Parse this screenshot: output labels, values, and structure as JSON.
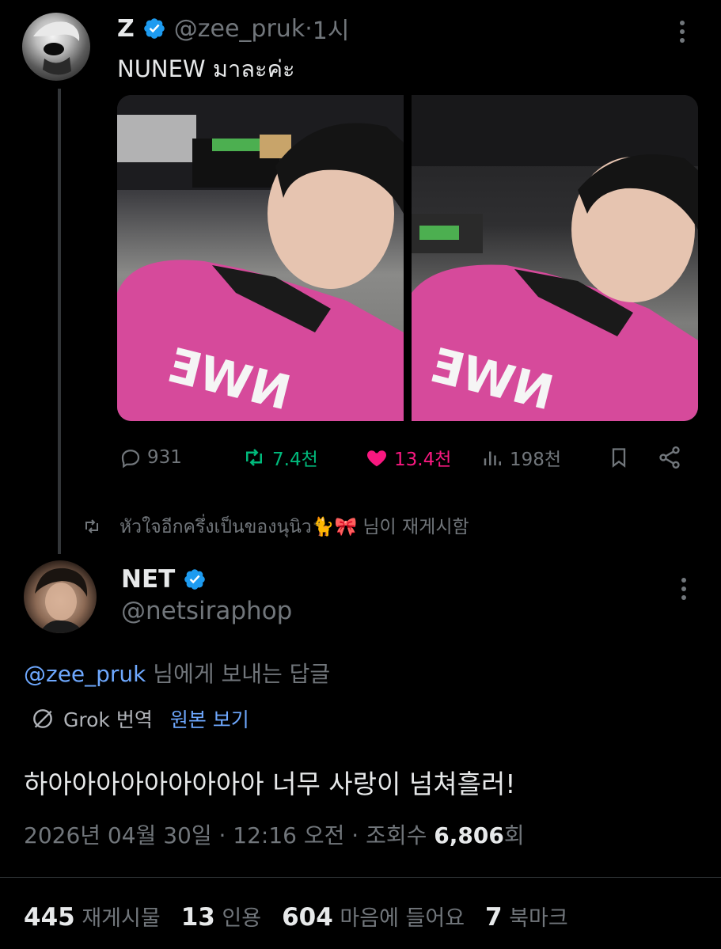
{
  "tweet1": {
    "name": "Z",
    "handle": "@zee_pruk",
    "sep": " · ",
    "time": "1시",
    "text": "NUNEW มาละค่ะ",
    "actions": {
      "replies": "931",
      "retweets": "7.4천",
      "likes": "13.4천",
      "views": "198천"
    }
  },
  "repost_notice": "หัวใจอีกครึ่งเป็นของนุนิว🐈🎀 님이 재게시함",
  "tweet2": {
    "name": "NET",
    "handle": "@netsiraphop",
    "reply_to_handle": "@zee_pruk",
    "reply_to_suffix": " 님에게 보내는 답글",
    "translate_label": "Grok 번역",
    "show_original": "원본 보기",
    "text": "하아아아아아아아아아 너무 사랑이 넘쳐흘러!",
    "meta_prefix": "2026년 04월 30일 · 12:16 오전 · 조회수 ",
    "views": "6,806",
    "views_suffix": "회",
    "stats": {
      "reposts_num": "445",
      "reposts_label": "재게시물",
      "quotes_num": "13",
      "quotes_label": "인용",
      "likes_num": "604",
      "likes_label": "마음에 들어요",
      "bookmarks_num": "7",
      "bookmarks_label": "북마크"
    }
  },
  "colors": {
    "background": "#000000",
    "text": "#e7e9ea",
    "muted": "#71767b",
    "verified": "#1d9bf0",
    "retweet_green": "#00ba7c",
    "like_pink": "#f91880",
    "link": "#6ea8fe"
  },
  "icons": [
    "verified-badge-icon",
    "more-icon",
    "reply-icon",
    "retweet-icon",
    "heart-icon",
    "views-icon",
    "bookmark-icon",
    "share-icon",
    "grok-icon"
  ]
}
